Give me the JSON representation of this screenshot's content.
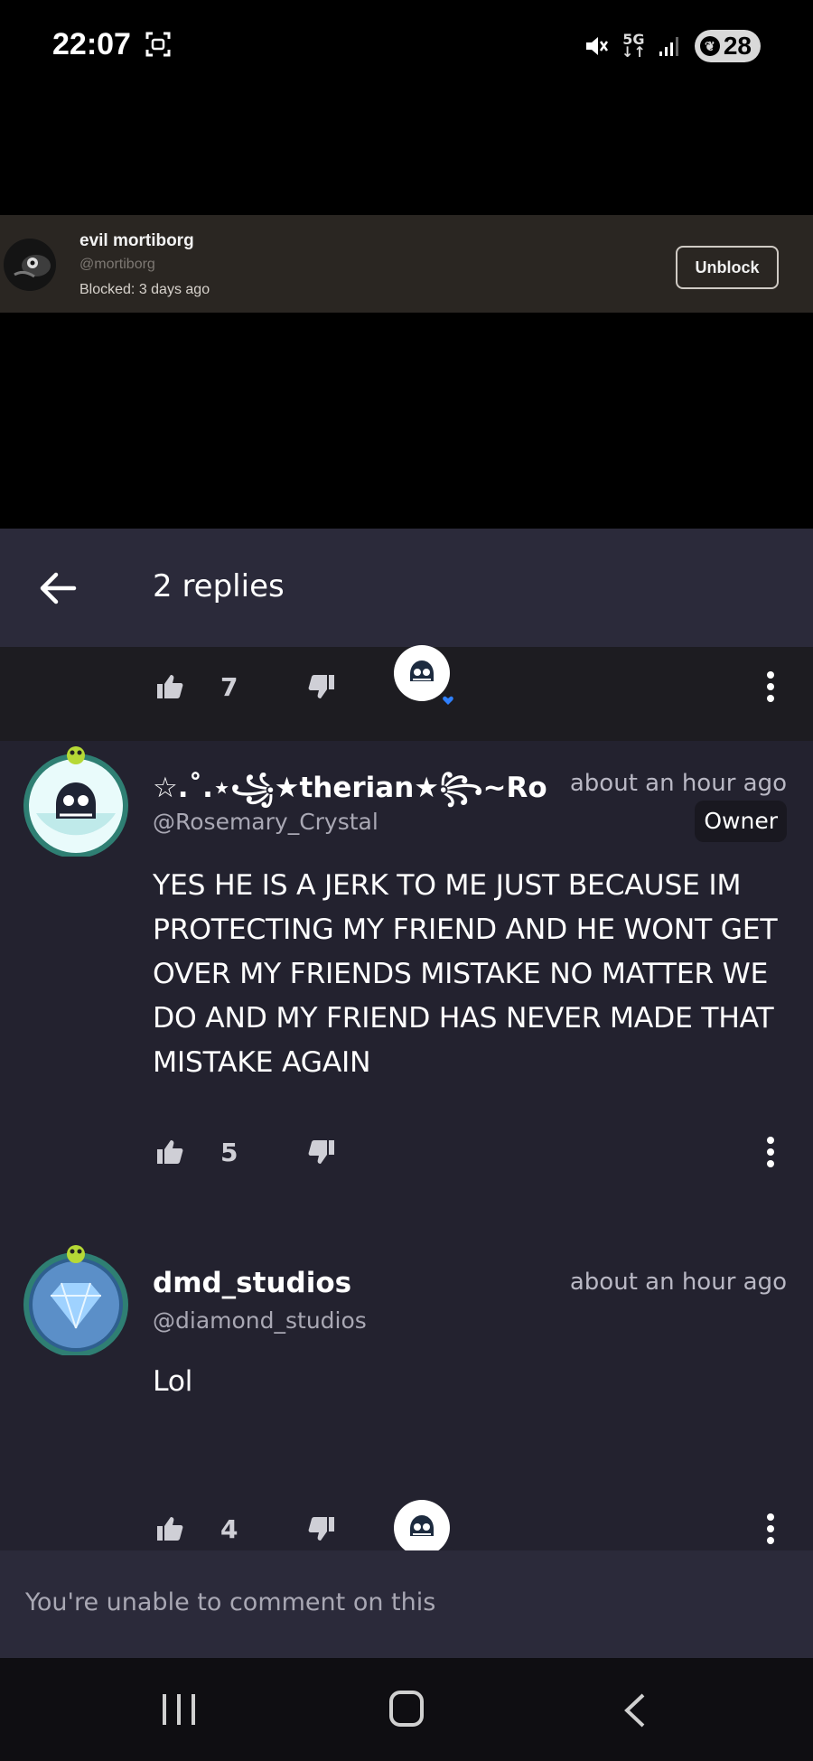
{
  "status_bar": {
    "time": "22:07",
    "network": "5G",
    "battery": "28",
    "icons": [
      "screenshot-icon",
      "mute-icon",
      "signal-icon",
      "battery-saver-icon"
    ]
  },
  "blocked_user": {
    "name": "evil mortiborg",
    "handle": "@mortiborg",
    "blocked_text": "Blocked: 3 days ago",
    "button": "Unblock"
  },
  "thread": {
    "title": "2 replies",
    "parent_likes": "7"
  },
  "comments": [
    {
      "author": "☆.˚.⋆꧁★therian★꧂~Ro",
      "time": "about an hour ago",
      "handle": "@Rosemary_Crystal",
      "badge": "Owner",
      "text": "YES HE IS A JERK TO ME JUST BECAUSE IM PROTECTING MY FRIEND AND HE WONT GET OVER MY FRIENDS MISTAKE NO MATTER WE DO AND MY FRIEND HAS NEVER MADE THAT MISTAKE AGAIN",
      "likes": "5"
    },
    {
      "author": "dmd_studios",
      "time": "about an hour ago",
      "handle": "@diamond_studios",
      "text": "Lol",
      "likes": "4"
    }
  ],
  "composer": {
    "text": "You're unable to comment on this"
  },
  "colors": {
    "panel": "#23222f",
    "header": "#2b2a3a",
    "heart": "#2f80ff"
  }
}
